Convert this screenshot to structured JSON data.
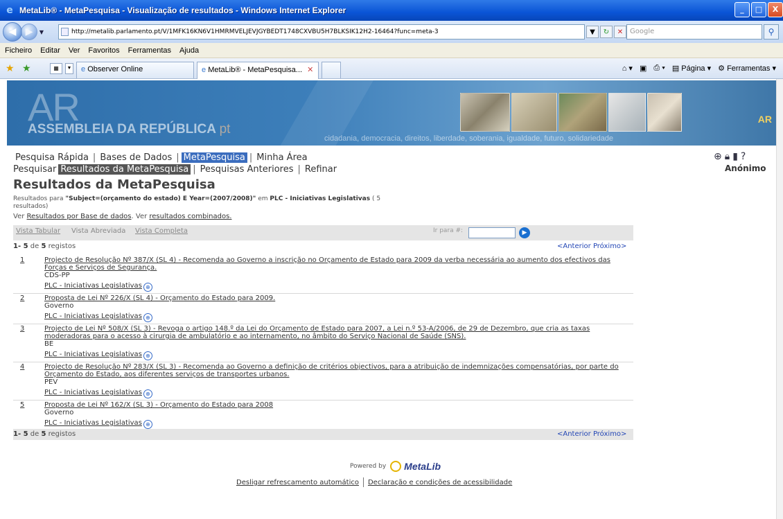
{
  "window": {
    "title": "MetaLib® - MetaPesquisa - Visualização de resultados - Windows Internet Explorer"
  },
  "address_bar": {
    "url": "http://metalib.parlamento.pt/V/1MFK16KN6V1HMRMVELJEVJGYBEDT1748CXVBU5H7BLKSIK12H2-16464?func=meta-3",
    "search_placeholder": "Google"
  },
  "menu": [
    "Ficheiro",
    "Editar",
    "Ver",
    "Favoritos",
    "Ferramentas",
    "Ajuda"
  ],
  "tabs": [
    {
      "label": "Observer Online"
    },
    {
      "label": "MetaLib® - MetaPesquisa..."
    }
  ],
  "tab_tools": {
    "page": "Página",
    "tools": "Ferramentas"
  },
  "banner": {
    "logo_big": "AR",
    "logo_text": "ASSEMBLEIA DA REPÚBLICA",
    "logo_suffix": "pt",
    "slogan": "cidadania, democracia, direitos, liberdade, soberania, igualdade, futuro, solidariedade",
    "right_mark": "AR"
  },
  "nav": {
    "row1": [
      "Pesquisa Rápida",
      "Bases de Dados",
      "MetaPesquisa",
      "Minha Área"
    ],
    "row2": [
      "Pesquisar",
      "Resultados da MetaPesquisa",
      "Pesquisas Anteriores",
      "Refinar"
    ],
    "user": "Anónimo"
  },
  "heading": "Resultados da MetaPesquisa",
  "results_for": {
    "prefix": "Resultados para",
    "query": "\"Subject=(orçamento do estado) E Year=(2007/2008)\"",
    "in": "em",
    "db": "PLC - Iniciativas Legislativas",
    "count": "( 5 resultados)"
  },
  "ver_line": {
    "ver1": "Ver",
    "link1": "Resultados por Base de dados",
    "ver2": ". Ver",
    "link2": "resultados combinados."
  },
  "views": {
    "tabular": "Vista Tabular",
    "abreviada": "Vista Abreviada",
    "completa": "Vista Completa",
    "goto_label": "Ir para #:"
  },
  "count": {
    "range": "1- 5",
    "of": "de",
    "total": "5",
    "label": "registos"
  },
  "pager": {
    "prev": "<Anterior",
    "next": "Próximo>"
  },
  "results": [
    {
      "num": "1",
      "title": "Projecto de Resolução Nº 387/X (SL 4) - Recomenda ao Governo a inscrição no Orçamento de Estado para 2009 da verba necessária ao aumento dos efectivos das Forças e Serviços de Segurança.",
      "author": "CDS-PP",
      "db": "PLC - Iniciativas Legislativas"
    },
    {
      "num": "2",
      "title": "Proposta de Lei Nº 226/X (SL 4) - Orçamento do Estado para 2009.",
      "author": "Governo",
      "db": "PLC - Iniciativas Legislativas"
    },
    {
      "num": "3",
      "title": "Projecto de Lei Nº 508/X (SL 3) - Revoga o artigo 148.º da Lei do Orçamento de Estado para 2007, a Lei n.º 53-A/2006, de 29 de Dezembro, que cria as taxas moderadoras para o acesso à cirurgia de ambulatório e ao internamento, no âmbito do Serviço Nacional de Saúde (SNS).",
      "author": "BE",
      "db": "PLC - Iniciativas Legislativas"
    },
    {
      "num": "4",
      "title": "Projecto de Resolução Nº 283/X (SL 3) - Recomenda ao Governo a definição de critérios objectivos, para a atribuição de indemnizações compensatórias, por parte do Orçamento do Estado, aos diferentes serviços de transportes urbanos.",
      "author": "PEV",
      "db": "PLC - Iniciativas Legislativas"
    },
    {
      "num": "5",
      "title": "Proposta de Lei Nº 162/X (SL 3) - Orçamento do Estado para 2008",
      "author": "Governo",
      "db": "PLC - Iniciativas Legislativas"
    }
  ],
  "powered": {
    "label": "Powered by",
    "brand": "MetaLib"
  },
  "footer": {
    "refresh": "Desligar refrescamento automático",
    "access": "Declaração e condições de acessibilidade"
  },
  "colors": {
    "nav_selected": "#3b6dbe",
    "subnav_selected": "#555555",
    "link": "#2346b5",
    "titlebar": "#0a54d6"
  }
}
